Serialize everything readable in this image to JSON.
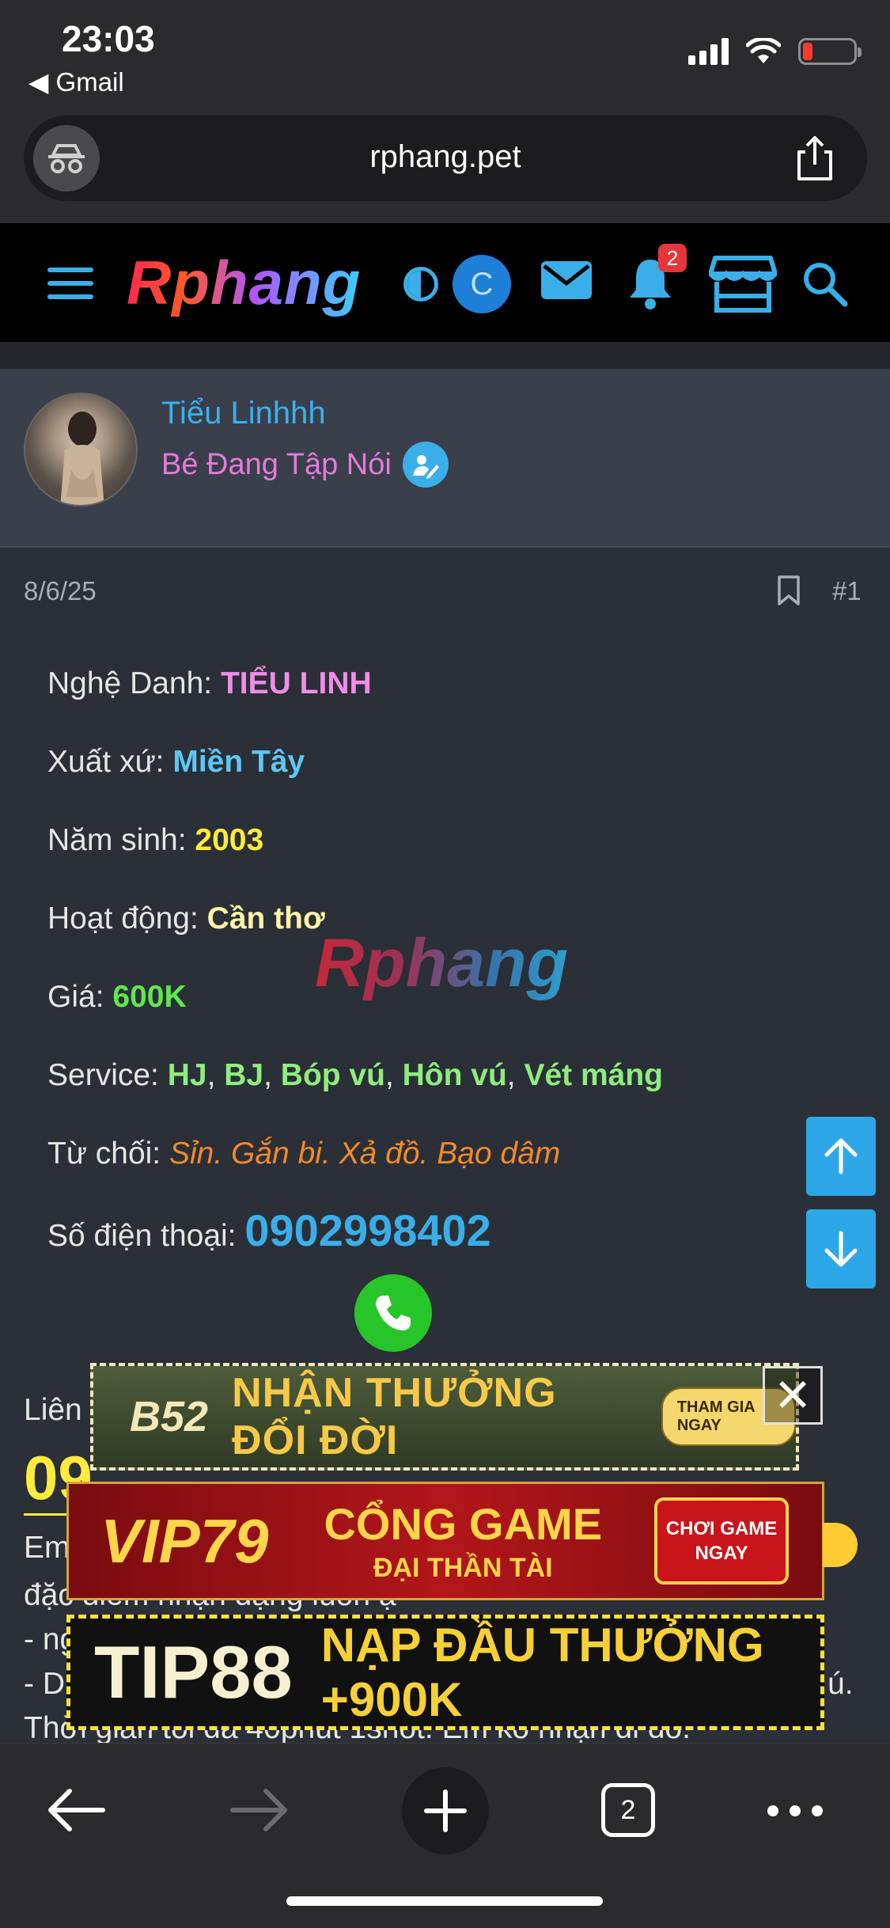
{
  "status_bar": {
    "time": "23:03",
    "back_app": "◀ Gmail"
  },
  "browser": {
    "url": "rphang.pet",
    "tab_count": "2"
  },
  "site_header": {
    "logo": "Rphang",
    "avatar_letter": "C",
    "notification_count": "2"
  },
  "author": {
    "name": "Tiểu Linhhh",
    "title": "Bé Đang Tập Nói"
  },
  "post": {
    "date": "8/6/25",
    "number": "#1",
    "watermark": "Rphang",
    "fields": {
      "stage_name_label": "Nghệ Danh: ",
      "stage_name": "TIỂU LINH",
      "origin_label": "Xuất xứ: ",
      "origin": "Miền Tây",
      "birth_year_label": "Năm sinh: ",
      "birth_year": "2003",
      "area_label": "Hoạt động: ",
      "area": "Cần thơ",
      "price_label": "Giá: ",
      "price": "600K",
      "service_label": "Service: ",
      "services": [
        "HJ",
        "BJ",
        "Bóp vú",
        "Hôn vú",
        "Vét máng"
      ],
      "service_sep": ", ",
      "refuse_label": "Từ chối: ",
      "refuse": "Sỉn. Gắn bi. Xả đồ. Bạo dâm",
      "phone_label": "Số điện thoại: ",
      "phone": "0902998402"
    },
    "partial_text": {
      "contact": "Liên",
      "big_number": "09",
      "line_em": "Em",
      "line_feature": "đặc điểm nhận dạng luôn ạ",
      "line_dash1": "- ng",
      "line_dash2": "- D",
      "line_dash2_end": "ú.",
      "line_time": "Thời gian tối đa 40phút 1shot. Em ko nhận đi đồ."
    }
  },
  "ads": {
    "b52": {
      "logo": "B52",
      "text": "NHẬN THƯỞNG ĐỔI ĐỜI",
      "cta": "THAM GIA NGAY"
    },
    "vip79": {
      "logo": "VIP79",
      "line1": "CỔNG GAME",
      "line2": "ĐẠI THẦN TÀI",
      "cta": "CHƠI GAME NGAY"
    },
    "tip88": {
      "logo": "TIP88",
      "text": "NẠP ĐẦU THƯỞNG +900K"
    },
    "close": "✕"
  },
  "colors": {
    "accent": "#3aaee8",
    "background": "#2b2f37",
    "header": "#000000",
    "author_card": "#3a3f4c"
  }
}
